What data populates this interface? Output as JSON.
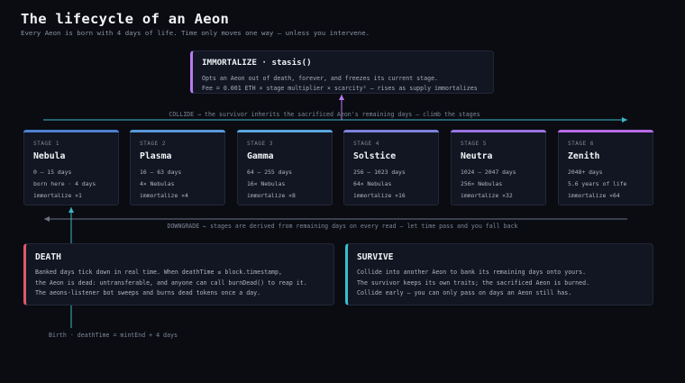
{
  "header": {
    "title": "The lifecycle of an Aeon",
    "subtitle": "Every Aeon is born with 4 days of life. Time only moves one way — unless you intervene."
  },
  "immortalize": {
    "title": "IMMORTALIZE · stasis()",
    "line1": "Opts an Aeon out of death, forever, and freezes its current stage.",
    "line2": "Fee = 0.001 ETH × stage multiplier × scarcity² — rises as supply immortalizes",
    "accent": "#b77af0"
  },
  "arrows": {
    "collide": "COLLIDE → the survivor inherits the sacrificed Aeon's remaining days — climb the stages",
    "downgrade": "DOWNGRADE ← stages are derived from remaining days on every read — let time pass and you fall back",
    "birth": "Birth · deathTime = mintEnd + 4 days"
  },
  "stages": [
    {
      "stage": "STAGE 1",
      "name": "Nebula",
      "range": "0 – 15 days",
      "info": "born here · 4 days",
      "mult": "immortalize ×1",
      "color": "#4e7fd1"
    },
    {
      "stage": "STAGE 2",
      "name": "Plasma",
      "range": "16 – 63 days",
      "info": "4× Nebulas",
      "mult": "immortalize ×4",
      "color": "#5a98d9"
    },
    {
      "stage": "STAGE 3",
      "name": "Gamma",
      "range": "64 – 255 days",
      "info": "16× Nebulas",
      "mult": "immortalize ×8",
      "color": "#5aa6dc"
    },
    {
      "stage": "STAGE 4",
      "name": "Solstice",
      "range": "256 – 1023 days",
      "info": "64× Nebulas",
      "mult": "immortalize ×16",
      "color": "#7f82dd"
    },
    {
      "stage": "STAGE 5",
      "name": "Neutra",
      "range": "1024 – 2047 days",
      "info": "256× Nebulas",
      "mult": "immortalize ×32",
      "color": "#9a73e3"
    },
    {
      "stage": "STAGE 6",
      "name": "Zenith",
      "range": "2048+ days",
      "info": "5.6 years of life",
      "mult": "immortalize ×64",
      "color": "#b86be8"
    }
  ],
  "death": {
    "title": "DEATH",
    "line1": "Banked days tick down in real time. When deathTime ≤ block.timestamp,",
    "line2": "the Aeon is dead: untransferable, and anyone can call burnDead() to reap it.",
    "line3": "The aeons-listener bot sweeps and burns dead tokens once a day.",
    "accent": "#e05a6a"
  },
  "survive": {
    "title": "SURVIVE",
    "line1": "Collide into another Aeon to bank its remaining days onto yours.",
    "line2": "The survivor keeps its own traits; the sacrificed Aeon is burned.",
    "line3": "Collide early — you can only pass on days an Aeon still has.",
    "accent": "#34c0cf"
  }
}
